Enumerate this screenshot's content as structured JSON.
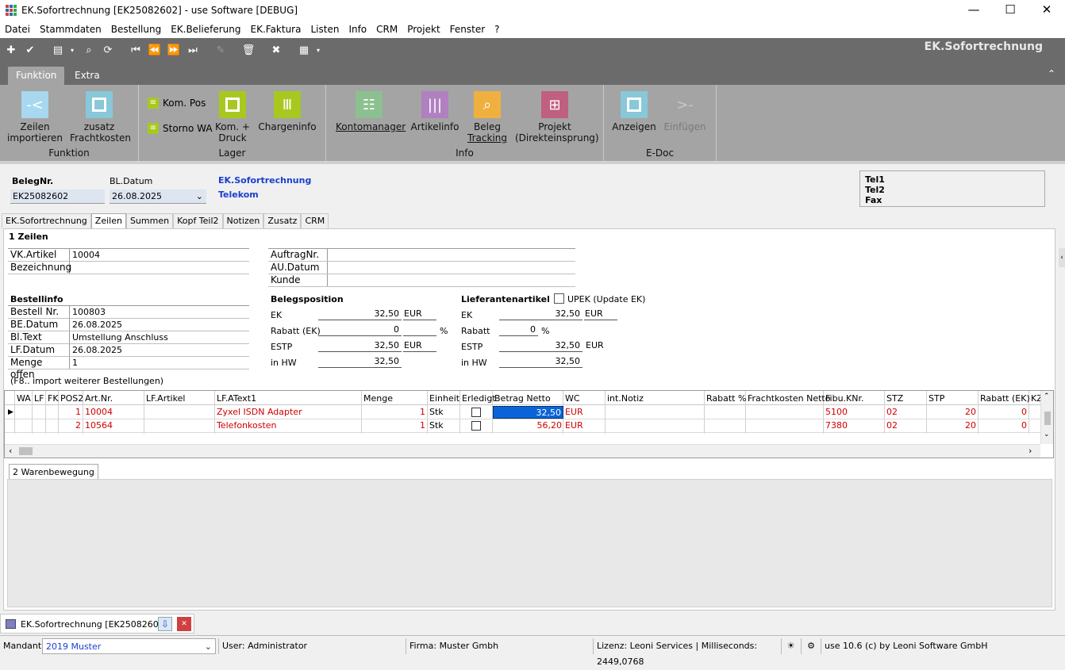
{
  "window": {
    "title": "EK.Sofortrechnung [EK25082602] - use Software [DEBUG]",
    "min": "—",
    "max": "☐",
    "close": "✕"
  },
  "menu": [
    "Datei",
    "Stammdaten",
    "Bestellung",
    "EK.Belieferung",
    "EK.Faktura",
    "Listen",
    "Info",
    "CRM",
    "Projekt",
    "Fenster",
    "?"
  ],
  "brand": "EK.Sofortrechnung",
  "ribbon_tabs": [
    "Funktion",
    "Extra"
  ],
  "ribbon": {
    "groups": [
      "Funktion",
      "Lager",
      "Info",
      "E-Doc"
    ],
    "btn_zeilen": [
      "Zeilen",
      "importieren"
    ],
    "btn_fracht": [
      "zusatz",
      "Frachtkosten"
    ],
    "btn_kompos": "Kom. Pos",
    "btn_storno": "Storno WA",
    "btn_komdruck": [
      "Kom. +",
      "Druck"
    ],
    "btn_charge": "Chargeninfo",
    "btn_konto": "Kontomanager",
    "btn_artikel": "Artikelinfo",
    "btn_beleg": [
      "Beleg",
      "Tracking"
    ],
    "btn_projekt": [
      "Projekt",
      "(Direkteinsprung)"
    ],
    "btn_anzeigen": "Anzeigen",
    "btn_einfuegen": "Einfügen",
    "colors": {
      "blue": "#a8d8ef",
      "lightblue": "#88c8d8",
      "lime": "#a8c820",
      "grey": "#8cc090",
      "purple": "#b080c0",
      "orange": "#f0b040",
      "magenta": "#c06080"
    }
  },
  "header": {
    "beleg_label": "BelegNr.",
    "beleg_value": "EK25082602",
    "datum_label": "BL.Datum",
    "datum_value": "26.08.2025",
    "doc_type": "EK.Sofortrechnung",
    "supplier": "Telekom",
    "tel1": "Tel1",
    "tel2": "Tel2",
    "fax": "Fax"
  },
  "tabs": [
    "EK.Sofortrechnung",
    "Zeilen",
    "Summen",
    "Kopf Teil2",
    "Notizen",
    "Zusatz",
    "CRM"
  ],
  "section_title": "1 Zeilen",
  "vk": {
    "artikel_label": "VK.Artikel",
    "artikel_value": "10004",
    "bez_label": "Bezeichnung",
    "bez_value": ""
  },
  "auftrag": {
    "nr": "AuftragNr.",
    "datum": "AU.Datum",
    "kunde": "Kunde"
  },
  "bestellinfo": {
    "title": "Bestellinfo",
    "rows": [
      {
        "k": "Bestell Nr.",
        "v": "100803"
      },
      {
        "k": "BE.Datum",
        "v": "26.08.2025"
      },
      {
        "k": "Bl.Text",
        "v": "Umstellung Anschluss"
      },
      {
        "k": "LF.Datum",
        "v": "26.08.2025"
      },
      {
        "k": "Menge offen",
        "v": "1"
      }
    ]
  },
  "belegposition": {
    "title": "Belegsposition",
    "ek_label": "EK",
    "ek_value": "32,50",
    "ek_cur": "EUR",
    "rabatt_label": "Rabatt (EK)",
    "rabatt_value": "0",
    "rabatt_unit": "%",
    "estp_label": "ESTP",
    "estp_value": "32,50",
    "estp_cur": "EUR",
    "hw_label": "in HW",
    "hw_value": "32,50"
  },
  "lieferantenartikel": {
    "title": "Lieferantenartikel",
    "upek": "UPEK (Update EK)",
    "ek_label": "EK",
    "ek_value": "32,50",
    "ek_cur": "EUR",
    "rabatt_label": "Rabatt",
    "rabatt_value": "0",
    "rabatt_unit": "%",
    "estp_label": "ESTP",
    "estp_value": "32,50",
    "estp_cur": "EUR",
    "hw_label": "in HW",
    "hw_value": "32,50"
  },
  "hint": "(F8.. import weiterer Bestellungen)",
  "grid": {
    "columns": [
      "WA",
      "LF",
      "FK",
      "POS2",
      "Art.Nr.",
      "LF.Artikel",
      "LF.AText1",
      "Menge",
      "Einheit",
      "Erledigt",
      "Betrag Netto",
      "WC",
      "int.Notiz",
      "Rabatt %",
      "Frachtkosten Netto",
      "Fibu.KNr.",
      "STZ",
      "STP",
      "Rabatt (EK)",
      "KZ"
    ],
    "rows": [
      {
        "pos": "1",
        "art": "10004",
        "text": "Zyxel ISDN Adapter",
        "menge": "1",
        "einheit": "Stk",
        "betrag": "32,50",
        "wc": "EUR",
        "fibu": "5100",
        "stz": "02",
        "stp": "20",
        "rabatt": "0"
      },
      {
        "pos": "2",
        "art": "10564",
        "text": "Telefonkosten",
        "menge": "1",
        "einheit": "Stk",
        "betrag": "56,20",
        "wc": "EUR",
        "fibu": "7380",
        "stz": "02",
        "stp": "20",
        "rabatt": "0"
      }
    ]
  },
  "lower_tab": "2 Warenbewegung",
  "taskbar": {
    "doc": "EK.Sofortrechnung [EK25082602]"
  },
  "status": {
    "mandant_label": "Mandant",
    "mandant_value": "2019 Muster",
    "user": "User: Administrator",
    "firma": "Firma: Muster Gmbh",
    "lizenz": "Lizenz: Leoni Services | Milliseconds: 2449,0768",
    "version": "use 10.6 (c) by Leoni Software GmbH"
  }
}
